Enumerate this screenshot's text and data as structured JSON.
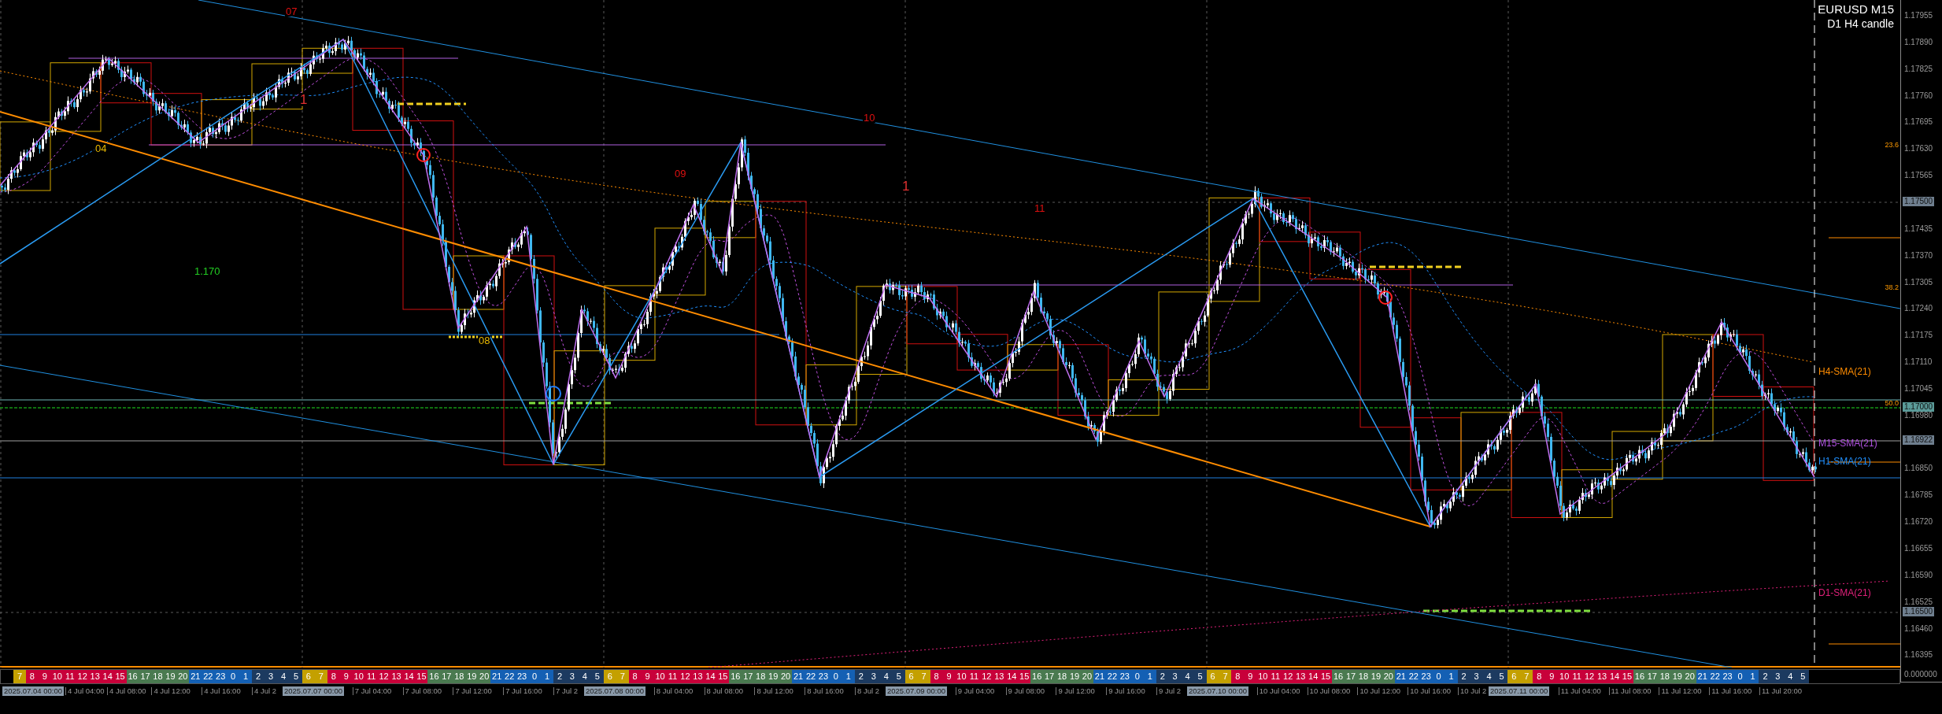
{
  "title": {
    "symbol": "EURUSD M15",
    "subtitle": "D1 H4 candle"
  },
  "chart_labels": [
    {
      "text": "07",
      "color": "#e01010"
    },
    {
      "text": "1",
      "color": "#e03030"
    },
    {
      "text": "04",
      "color": "#e8b800"
    },
    {
      "text": "09",
      "color": "#e01010"
    },
    {
      "text": "10",
      "color": "#e01010"
    },
    {
      "text": "1",
      "color": "#e03030"
    },
    {
      "text": "11",
      "color": "#e01010"
    },
    {
      "text": "08",
      "color": "#e8b800"
    },
    {
      "text": "1.170",
      "color": "#22cc22"
    }
  ],
  "fib_levels": [
    "23.6",
    "38.2",
    "50.0"
  ],
  "sma_labels": [
    {
      "text": "H4-SMA(21)",
      "color": "#ff8c00"
    },
    {
      "text": "M15-SMA(21)",
      "color": "#b050e0"
    },
    {
      "text": "H1-SMA(21)",
      "color": "#2090ff"
    },
    {
      "text": "D1-SMA(21)",
      "color": "#e0207a"
    }
  ],
  "price_axis": {
    "ticks": [
      "1.17955",
      "1.17890",
      "1.17825",
      "1.17760",
      "1.17695",
      "1.17630",
      "1.17565",
      "1.17435",
      "1.17370",
      "1.17305",
      "1.17240",
      "1.17175",
      "1.17110",
      "1.17045",
      "1.16980",
      "1.16850",
      "1.16785",
      "1.16720",
      "1.16655",
      "1.16590",
      "1.16525",
      "1.16460",
      "1.16395"
    ],
    "markers": [
      {
        "text": "1.17500",
        "color": "#6f7f8f"
      },
      {
        "text": "1.17000",
        "color": "#5a9a98"
      },
      {
        "text": "1.16922",
        "color": "#6f7f8f"
      },
      {
        "text": "1.16500",
        "color": "#6f7f8f"
      }
    ],
    "footer": "0.000000"
  },
  "session_bar": [
    {
      "groups": [
        {
          "kind": "tokyo",
          "hours": [
            "7"
          ]
        },
        {
          "kind": "london",
          "hours": [
            "8",
            "9",
            "10",
            "11",
            "12",
            "13",
            "14",
            "15"
          ]
        },
        {
          "kind": "overlap",
          "hours": [
            "16",
            "17",
            "18",
            "19",
            "20"
          ]
        },
        {
          "kind": "newyork",
          "hours": [
            "21",
            "22",
            "23",
            "0",
            "1"
          ]
        },
        {
          "kind": "night",
          "hours": [
            "2",
            "3",
            "4",
            "5"
          ]
        }
      ]
    },
    {
      "groups": [
        {
          "kind": "tokyo",
          "hours": [
            "6",
            "7"
          ]
        },
        {
          "kind": "london",
          "hours": [
            "8",
            "9",
            "10",
            "11",
            "12",
            "13",
            "14",
            "15"
          ]
        },
        {
          "kind": "overlap",
          "hours": [
            "16",
            "17",
            "18",
            "19",
            "20"
          ]
        },
        {
          "kind": "newyork",
          "hours": [
            "21",
            "22",
            "23",
            "0",
            "1"
          ]
        },
        {
          "kind": "night",
          "hours": [
            "2",
            "3",
            "4",
            "5"
          ]
        }
      ]
    },
    {
      "groups": [
        {
          "kind": "tokyo",
          "hours": [
            "6",
            "7"
          ]
        },
        {
          "kind": "london",
          "hours": [
            "8",
            "9",
            "10",
            "11",
            "12",
            "13",
            "14",
            "15"
          ]
        },
        {
          "kind": "overlap",
          "hours": [
            "16",
            "17",
            "18",
            "19",
            "20"
          ]
        },
        {
          "kind": "newyork",
          "hours": [
            "21",
            "22",
            "23",
            "0",
            "1"
          ]
        },
        {
          "kind": "night",
          "hours": [
            "2",
            "3",
            "4",
            "5"
          ]
        }
      ]
    },
    {
      "groups": [
        {
          "kind": "tokyo",
          "hours": [
            "6",
            "7"
          ]
        },
        {
          "kind": "london",
          "hours": [
            "8",
            "9",
            "10",
            "11",
            "12",
            "13",
            "14",
            "15"
          ]
        },
        {
          "kind": "overlap",
          "hours": [
            "16",
            "17",
            "18",
            "19",
            "20"
          ]
        },
        {
          "kind": "newyork",
          "hours": [
            "21",
            "22",
            "23",
            "0",
            "1"
          ]
        },
        {
          "kind": "night",
          "hours": [
            "2",
            "3",
            "4",
            "5"
          ]
        }
      ]
    },
    {
      "groups": [
        {
          "kind": "tokyo",
          "hours": [
            "6",
            "7"
          ]
        },
        {
          "kind": "london",
          "hours": [
            "8",
            "9",
            "10",
            "11",
            "12",
            "13",
            "14",
            "15"
          ]
        },
        {
          "kind": "overlap",
          "hours": [
            "16",
            "17",
            "18",
            "19",
            "20"
          ]
        },
        {
          "kind": "newyork",
          "hours": [
            "21",
            "22",
            "23",
            "0",
            "1"
          ]
        },
        {
          "kind": "night",
          "hours": [
            "2",
            "3",
            "4",
            "5"
          ]
        }
      ]
    },
    {
      "groups": [
        {
          "kind": "tokyo",
          "hours": [
            "6",
            "7"
          ]
        },
        {
          "kind": "london",
          "hours": [
            "8",
            "9",
            "10",
            "11",
            "12",
            "13",
            "14",
            "15"
          ]
        },
        {
          "kind": "overlap",
          "hours": [
            "16",
            "17",
            "18",
            "19",
            "20"
          ]
        },
        {
          "kind": "newyork",
          "hours": [
            "21",
            "22",
            "23",
            "0",
            "1"
          ]
        },
        {
          "kind": "night",
          "hours": [
            "2",
            "3",
            "4",
            "5"
          ]
        }
      ]
    }
  ],
  "time_axis": [
    {
      "date": "2025.07.04 00:00",
      "times": [
        "4 Jul 04:00",
        "4 Jul 08:00",
        "4 Jul 12:00",
        "4 Jul 16:00",
        "4 Jul 2"
      ]
    },
    {
      "date": "2025.07.07 00:00",
      "times": [
        "7 Jul 04:00",
        "7 Jul 08:00",
        "7 Jul 12:00",
        "7 Jul 16:00",
        "7 Jul 2"
      ]
    },
    {
      "date": "2025.07.08 00:00",
      "times": [
        "8 Jul 04:00",
        "8 Jul 08:00",
        "8 Jul 12:00",
        "8 Jul 16:00",
        "8 Jul 2"
      ]
    },
    {
      "date": "2025.07.09 00:00",
      "times": [
        "9 Jul 04:00",
        "9 Jul 08:00",
        "9 Jul 12:00",
        "9 Jul 16:00",
        "9 Jul 2"
      ]
    },
    {
      "date": "2025.07.10 00:00",
      "times": [
        "10 Jul 04:00",
        "10 Jul 08:00",
        "10 Jul 12:00",
        "10 Jul 16:00",
        "10 Jul 2"
      ]
    },
    {
      "date": "2025.07.11 00:00",
      "times": [
        "11 Jul 04:00",
        "11 Jul 08:00",
        "11 Jul 12:00",
        "11 Jul 16:00",
        "11 Jul 20:00"
      ]
    }
  ]
}
